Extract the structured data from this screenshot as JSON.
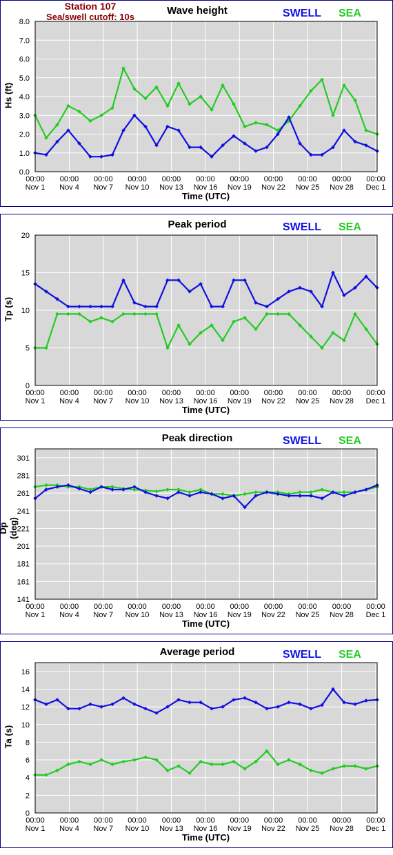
{
  "station": {
    "name": "Station 107",
    "cutoff": "Sea/swell cutoff: 10s"
  },
  "colors": {
    "swell": "#1010e0",
    "sea": "#22cc22",
    "border": "#000080",
    "plot_bg": "#d8d8d8",
    "grid": "#ffffff"
  },
  "x_ticks": [
    [
      "00:00",
      "Nov 1"
    ],
    [
      "00:00",
      "Nov 4"
    ],
    [
      "00:00",
      "Nov 7"
    ],
    [
      "00:00",
      "Nov 10"
    ],
    [
      "00:00",
      "Nov 13"
    ],
    [
      "00:00",
      "Nov 16"
    ],
    [
      "00:00",
      "Nov 19"
    ],
    [
      "00:00",
      "Nov 22"
    ],
    [
      "00:00",
      "Nov 25"
    ],
    [
      "00:00",
      "Nov 28"
    ],
    [
      "00:00",
      "Dec 1"
    ]
  ],
  "chart_data": [
    {
      "type": "line",
      "title": "Wave height",
      "xlabel": "Time (UTC)",
      "ylabel": "Hs (ft)",
      "ylim": [
        0,
        8
      ],
      "yticks": [
        "0.0",
        "1.0",
        "2.0",
        "3.0",
        "4.0",
        "5.0",
        "6.0",
        "7.0",
        "8.0"
      ],
      "x": [
        "Nov 1",
        "Nov 2",
        "Nov 3",
        "Nov 4",
        "Nov 5",
        "Nov 6",
        "Nov 7",
        "Nov 8",
        "Nov 9",
        "Nov 10",
        "Nov 11",
        "Nov 12",
        "Nov 13",
        "Nov 14",
        "Nov 15",
        "Nov 16",
        "Nov 17",
        "Nov 18",
        "Nov 19",
        "Nov 20",
        "Nov 21",
        "Nov 22",
        "Nov 23",
        "Nov 24",
        "Nov 25",
        "Nov 26",
        "Nov 27",
        "Nov 28",
        "Nov 29",
        "Nov 30",
        "Dec 1",
        "Dec 2"
      ],
      "series": [
        {
          "name": "SWELL",
          "values": [
            1.0,
            0.9,
            1.6,
            2.2,
            1.5,
            0.8,
            0.8,
            0.9,
            2.2,
            3.0,
            2.4,
            1.4,
            2.4,
            2.2,
            1.3,
            1.3,
            0.8,
            1.4,
            1.9,
            1.5,
            1.1,
            1.3,
            2.0,
            2.9,
            1.5,
            0.9,
            0.9,
            1.3,
            2.2,
            1.6,
            1.4,
            1.1
          ]
        },
        {
          "name": "SEA",
          "values": [
            3.0,
            1.8,
            2.5,
            3.5,
            3.2,
            2.7,
            3.0,
            3.4,
            5.5,
            4.4,
            3.9,
            4.5,
            3.5,
            4.7,
            3.6,
            4.0,
            3.3,
            4.6,
            3.6,
            2.4,
            2.6,
            2.5,
            2.2,
            2.7,
            3.5,
            4.3,
            4.9,
            3.0,
            4.6,
            3.8,
            2.2,
            2.0
          ]
        }
      ]
    },
    {
      "type": "line",
      "title": "Peak period",
      "xlabel": "Time (UTC)",
      "ylabel": "Tp (s)",
      "ylim": [
        0,
        20
      ],
      "yticks": [
        "0",
        "5",
        "10",
        "15",
        "20"
      ],
      "x": [
        "Nov 1",
        "Nov 2",
        "Nov 3",
        "Nov 4",
        "Nov 5",
        "Nov 6",
        "Nov 7",
        "Nov 8",
        "Nov 9",
        "Nov 10",
        "Nov 11",
        "Nov 12",
        "Nov 13",
        "Nov 14",
        "Nov 15",
        "Nov 16",
        "Nov 17",
        "Nov 18",
        "Nov 19",
        "Nov 20",
        "Nov 21",
        "Nov 22",
        "Nov 23",
        "Nov 24",
        "Nov 25",
        "Nov 26",
        "Nov 27",
        "Nov 28",
        "Nov 29",
        "Nov 30",
        "Dec 1",
        "Dec 2"
      ],
      "series": [
        {
          "name": "SWELL",
          "values": [
            13.5,
            12.5,
            11.5,
            10.5,
            10.5,
            10.5,
            10.5,
            10.5,
            14.0,
            11.0,
            10.5,
            10.5,
            14.0,
            14.0,
            12.5,
            13.5,
            10.5,
            10.5,
            14.0,
            14.0,
            11.0,
            10.5,
            11.5,
            12.5,
            13.0,
            12.5,
            10.5,
            15.0,
            12.0,
            13.0,
            14.5,
            13.0
          ]
        },
        {
          "name": "SEA",
          "values": [
            5.0,
            5.0,
            9.5,
            9.5,
            9.5,
            8.5,
            9.0,
            8.5,
            9.5,
            9.5,
            9.5,
            9.5,
            5.0,
            8.0,
            5.5,
            7.0,
            8.0,
            6.0,
            8.5,
            9.0,
            7.5,
            9.5,
            9.5,
            9.5,
            8.0,
            6.5,
            5.0,
            7.0,
            6.0,
            9.5,
            7.5,
            5.5
          ]
        }
      ]
    },
    {
      "type": "line",
      "title": "Peak direction",
      "xlabel": "Time (UTC)",
      "ylabel": "Dp (deg)",
      "ylim": [
        141,
        311
      ],
      "yticks": [
        "141",
        "161",
        "181",
        "201",
        "221",
        "241",
        "261",
        "281",
        "301"
      ],
      "x": [
        "Nov 1",
        "Nov 2",
        "Nov 3",
        "Nov 4",
        "Nov 5",
        "Nov 6",
        "Nov 7",
        "Nov 8",
        "Nov 9",
        "Nov 10",
        "Nov 11",
        "Nov 12",
        "Nov 13",
        "Nov 14",
        "Nov 15",
        "Nov 16",
        "Nov 17",
        "Nov 18",
        "Nov 19",
        "Nov 20",
        "Nov 21",
        "Nov 22",
        "Nov 23",
        "Nov 24",
        "Nov 25",
        "Nov 26",
        "Nov 27",
        "Nov 28",
        "Nov 29",
        "Nov 30",
        "Dec 1",
        "Dec 2"
      ],
      "series": [
        {
          "name": "SWELL",
          "values": [
            255,
            265,
            268,
            270,
            266,
            262,
            268,
            265,
            265,
            268,
            262,
            258,
            255,
            262,
            258,
            262,
            260,
            255,
            258,
            245,
            258,
            262,
            260,
            258,
            258,
            258,
            255,
            262,
            258,
            262,
            265,
            270
          ]
        },
        {
          "name": "SEA",
          "values": [
            268,
            270,
            270,
            268,
            268,
            265,
            268,
            268,
            266,
            265,
            264,
            263,
            265,
            265,
            262,
            265,
            260,
            260,
            258,
            260,
            262,
            262,
            262,
            260,
            262,
            262,
            265,
            262,
            262,
            262,
            265,
            268
          ]
        }
      ]
    },
    {
      "type": "line",
      "title": "Average period",
      "xlabel": "Time (UTC)",
      "ylabel": "Ta (s)",
      "ylim": [
        0,
        17
      ],
      "yticks": [
        "0",
        "2",
        "4",
        "6",
        "8",
        "10",
        "12",
        "14",
        "16"
      ],
      "x": [
        "Nov 1",
        "Nov 2",
        "Nov 3",
        "Nov 4",
        "Nov 5",
        "Nov 6",
        "Nov 7",
        "Nov 8",
        "Nov 9",
        "Nov 10",
        "Nov 11",
        "Nov 12",
        "Nov 13",
        "Nov 14",
        "Nov 15",
        "Nov 16",
        "Nov 17",
        "Nov 18",
        "Nov 19",
        "Nov 20",
        "Nov 21",
        "Nov 22",
        "Nov 23",
        "Nov 24",
        "Nov 25",
        "Nov 26",
        "Nov 27",
        "Nov 28",
        "Nov 29",
        "Nov 30",
        "Dec 1",
        "Dec 2"
      ],
      "series": [
        {
          "name": "SWELL",
          "values": [
            12.8,
            12.3,
            12.8,
            11.8,
            11.8,
            12.3,
            12.0,
            12.3,
            13.0,
            12.3,
            11.8,
            11.3,
            12.0,
            12.8,
            12.5,
            12.5,
            11.8,
            12.0,
            12.8,
            13.0,
            12.5,
            11.8,
            12.0,
            12.5,
            12.3,
            11.8,
            12.2,
            14.0,
            12.5,
            12.3,
            12.7,
            12.8
          ]
        },
        {
          "name": "SEA",
          "values": [
            4.3,
            4.3,
            4.8,
            5.5,
            5.8,
            5.5,
            6.0,
            5.5,
            5.8,
            6.0,
            6.3,
            6.0,
            4.8,
            5.3,
            4.5,
            5.8,
            5.5,
            5.5,
            5.8,
            5.0,
            5.8,
            7.0,
            5.5,
            6.0,
            5.5,
            4.8,
            4.5,
            5.0,
            5.3,
            5.3,
            5.0,
            5.3
          ]
        }
      ]
    }
  ]
}
